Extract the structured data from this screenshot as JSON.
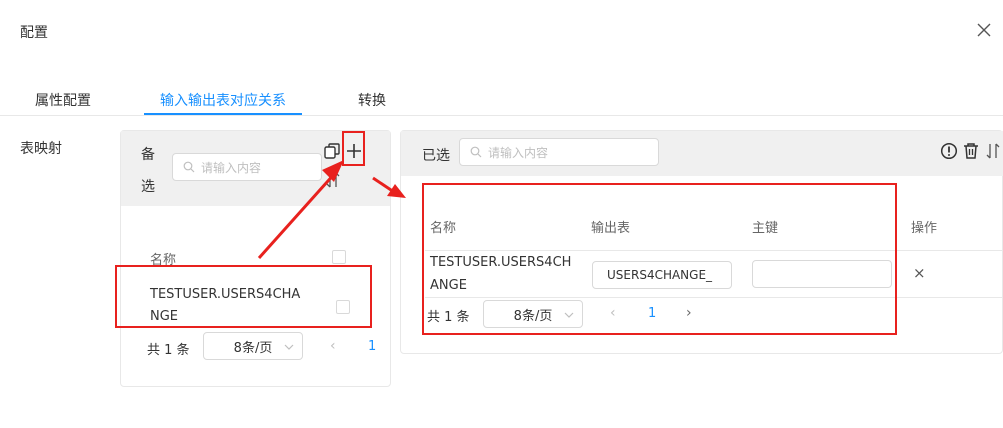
{
  "dialog": {
    "title": "配置"
  },
  "tabs": [
    {
      "label": "属性配置",
      "active": false
    },
    {
      "label": "输入输出表对应关系",
      "active": true
    },
    {
      "label": "转换",
      "active": false
    }
  ],
  "form": {
    "table_mapping_label": "表映射"
  },
  "left_panel": {
    "title_line1": "备",
    "title_line2": "选",
    "search_placeholder": "请输入内容",
    "column_name": "名称",
    "rows": [
      {
        "name_line1": "TESTUSER.USERS4CHA",
        "name_line2": "NGE"
      }
    ],
    "pagination": {
      "total": "共 1 条",
      "page_size": "8条/页",
      "prev": "‹",
      "current_page": "1"
    }
  },
  "right_panel": {
    "title": "已选",
    "search_placeholder": "请输入内容",
    "columns": {
      "name": "名称",
      "output_table": "输出表",
      "primary_key": "主键",
      "action": "操作"
    },
    "rows": [
      {
        "name_line1": "TESTUSER.USERS4CH",
        "name_line2": "ANGE",
        "output_table": "USERS4CHANGE_",
        "primary_key": "",
        "action": "×"
      }
    ],
    "pagination": {
      "total": "共 1 条",
      "page_size": "8条/页",
      "prev": "‹",
      "current_page": "1",
      "next": "›"
    }
  },
  "colors": {
    "accent": "#1890ff",
    "annotation": "#e8211e",
    "header_bg": "#f0f0f0"
  }
}
